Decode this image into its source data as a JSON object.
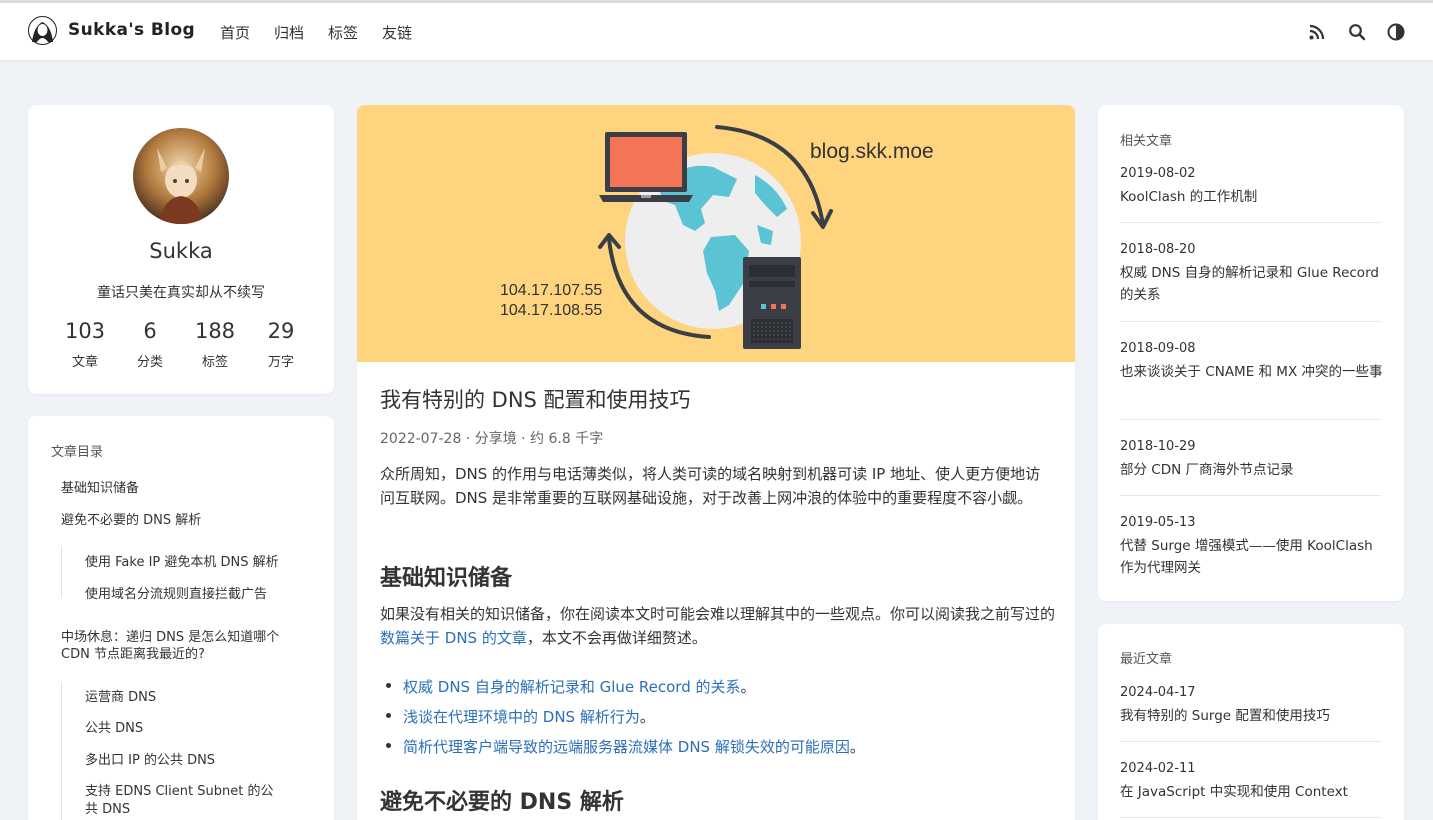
{
  "header": {
    "site_title": "Sukka's Blog",
    "nav": [
      "首页",
      "归档",
      "标签",
      "友链"
    ],
    "icons": [
      "rss-icon",
      "search-icon",
      "theme-toggle-icon"
    ]
  },
  "profile": {
    "name": "Sukka",
    "motto": "童话只美在真实却从不续写",
    "stats": [
      {
        "value": "103",
        "label": "文章"
      },
      {
        "value": "6",
        "label": "分类"
      },
      {
        "value": "188",
        "label": "标签"
      },
      {
        "value": "29",
        "label": "万字"
      }
    ]
  },
  "toc": {
    "title": "文章目录",
    "items": [
      "基础知识储备",
      "避免不必要的 DNS 解析",
      "使用 Fake IP 避免本机 DNS 解析",
      "使用域名分流规则直接拦截广告",
      "中场休息：递归 DNS 是怎么知道哪个",
      "CDN 节点距离我最近的?",
      "运营商 DNS",
      "公共 DNS",
      "多出口 IP 的公共 DNS",
      "支持 EDNS Client Subnet 的公",
      "共 DNS"
    ]
  },
  "article": {
    "hero": {
      "domain": "blog.skk.moe",
      "ip1": "104.17.107.55",
      "ip2": "104.17.108.55"
    },
    "title": "我有特别的 DNS 配置和使用技巧",
    "meta": "2022-07-28 · 分享境 · 约 6.8 千字",
    "intro": "众所周知，DNS 的作用与电话薄类似，将人类可读的域名映射到机器可读 IP 地址、使人更方便地访问互联网。DNS 是非常重要的互联网基础设施，对于改善上网冲浪的体验中的重要程度不容小觑。",
    "h2_1": "基础知识储备",
    "p2_before": "如果没有相关的知识储备，你在阅读本文时可能会难以理解其中的一些观点。你可以阅读我之前写过的 ",
    "p2_link": "数篇关于 DNS 的文章",
    "p2_after": "，本文不会再做详细赘述。",
    "links": [
      "权威 DNS 自身的解析记录和 Glue Record 的关系",
      "浅谈在代理环境中的 DNS 解析行为",
      "简析代理客户端导致的远端服务器流媒体 DNS 解锁失效的可能原因"
    ],
    "period": "。",
    "h2_2": "避免不必要的 DNS 解析"
  },
  "related": {
    "title": "相关文章",
    "items": [
      {
        "date": "2019-08-02",
        "title": "KoolClash 的工作机制"
      },
      {
        "date": "2018-08-20",
        "title": "权威 DNS 自身的解析记录和 Glue Record 的关系"
      },
      {
        "date": "2018-09-08",
        "title": "也来谈谈关于 CNAME 和 MX 冲突的一些事"
      },
      {
        "date": "2018-10-29",
        "title": "部分 CDN 厂商海外节点记录"
      },
      {
        "date": "2019-05-13",
        "title": "代替 Surge 增强模式——使用 KoolClash 作为代理网关"
      }
    ]
  },
  "recent": {
    "title": "最近文章",
    "items": [
      {
        "date": "2024-04-17",
        "title": "我有特别的 Surge 配置和使用技巧"
      },
      {
        "date": "2024-02-11",
        "title": "在 JavaScript 中实现和使用 Context"
      }
    ]
  },
  "colors": {
    "background": "#eff2f7",
    "hero": "#fed47e",
    "link": "#2a6fb7",
    "screen": "#f47458"
  }
}
